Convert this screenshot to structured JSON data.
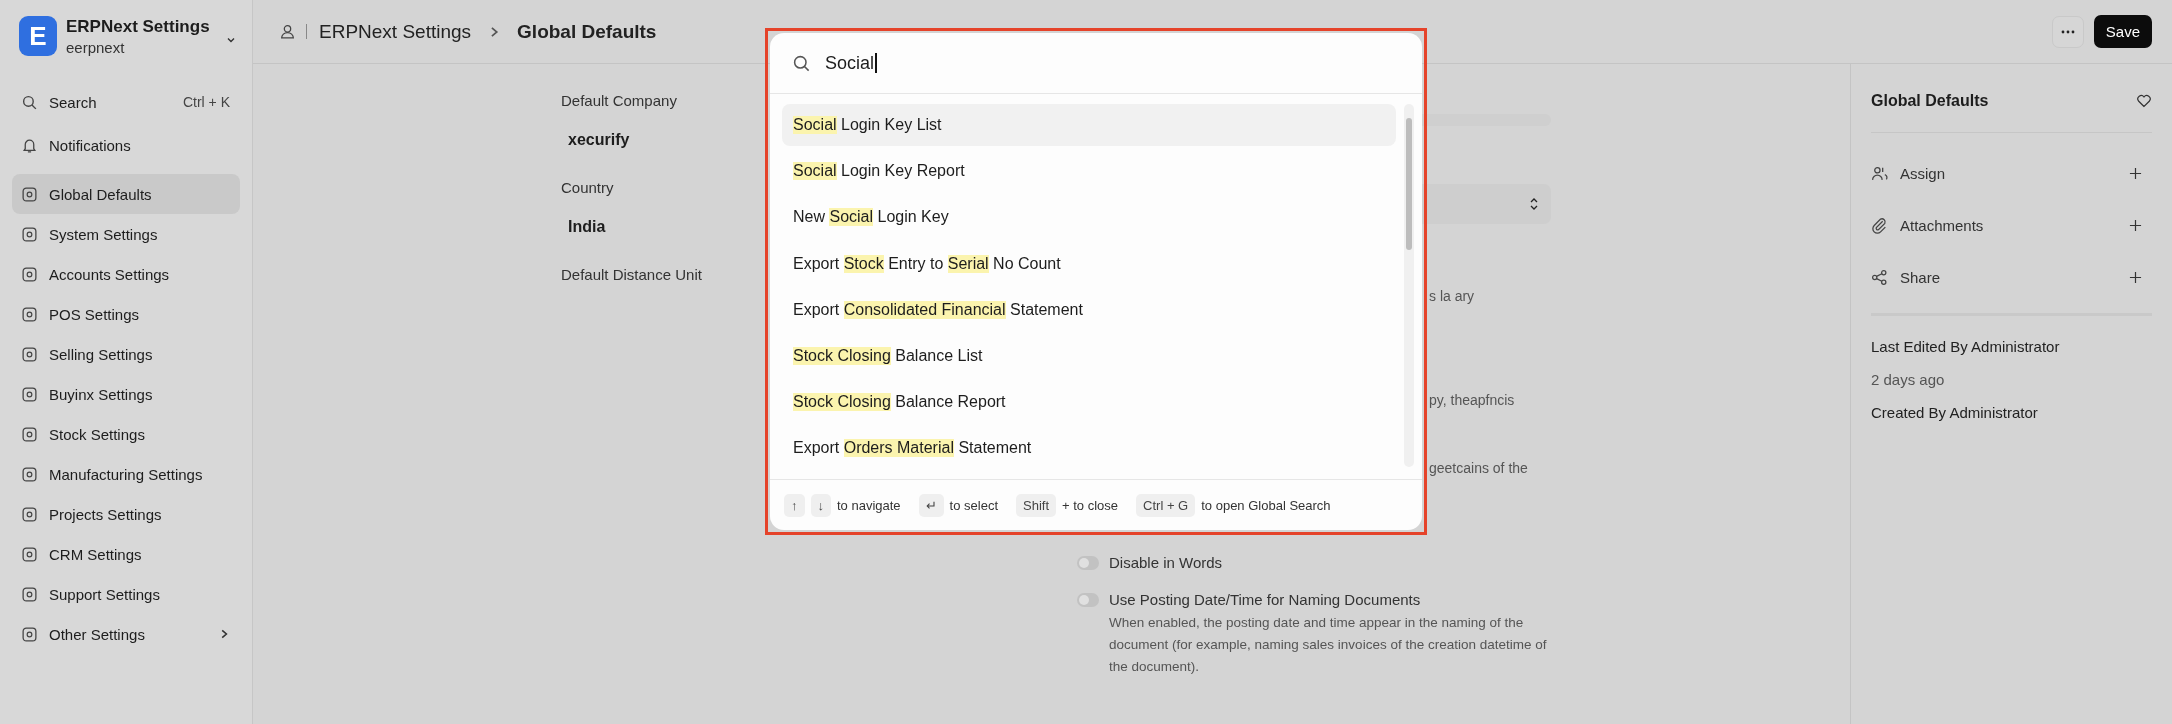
{
  "sidebar": {
    "app": {
      "logo": "E",
      "title": "ERPNext Settings",
      "subtitle": "eerpnext"
    },
    "search": {
      "label": "Search",
      "shortcut": "Ctrl + K"
    },
    "notifications": {
      "label": "Notifications"
    },
    "items": [
      {
        "label": "Global Defaults",
        "selected": true,
        "has_submenu": false
      },
      {
        "label": "System Settings",
        "selected": false,
        "has_submenu": false
      },
      {
        "label": "Accounts Settings",
        "selected": false,
        "has_submenu": false
      },
      {
        "label": "POS Settings",
        "selected": false,
        "has_submenu": false
      },
      {
        "label": "Selling Settings",
        "selected": false,
        "has_submenu": false
      },
      {
        "label": "Buyinx Settings",
        "selected": false,
        "has_submenu": false
      },
      {
        "label": "Stock Settings",
        "selected": false,
        "has_submenu": false
      },
      {
        "label": "Manufacturing Settings",
        "selected": false,
        "has_submenu": false
      },
      {
        "label": "Projects Settings",
        "selected": false,
        "has_submenu": false
      },
      {
        "label": "CRM Settings",
        "selected": false,
        "has_submenu": false
      },
      {
        "label": "Support Settings",
        "selected": false,
        "has_submenu": false
      },
      {
        "label": "Other Settings",
        "selected": false,
        "has_submenu": true
      }
    ]
  },
  "header": {
    "breadcrumbs": [
      "ERPNext Settings",
      "Global Defaults"
    ],
    "save_button": "Save"
  },
  "form": {
    "fields": [
      {
        "label": "Default Company",
        "value": "xecurify"
      },
      {
        "label": "Country",
        "value": "India"
      },
      {
        "label": "Default Distance Unit"
      }
    ],
    "fragments": [
      "s la ary",
      "py, theapfncis",
      "geetcains of the"
    ],
    "toggles": [
      {
        "label": "Disable in Words",
        "on": false
      },
      {
        "label": "Use Posting Date/Time for Naming Documents",
        "on": false,
        "description": "When enabled, the posting date and time appear in the naming of the document (for example, naming sales invoices of the creation datetime of the document)."
      }
    ]
  },
  "side_panel": {
    "title": "Global Defaults",
    "actions": [
      {
        "label": "Assign",
        "kind": "people"
      },
      {
        "label": "Attachments",
        "kind": "clip"
      },
      {
        "label": "Share",
        "kind": "share"
      }
    ],
    "last_edited": "Last Edited By Administrator",
    "last_edited_time": "2 days ago",
    "created": "Created By Administrator"
  },
  "search_dialog": {
    "query": "Social",
    "results": [
      {
        "selected": true,
        "parts": [
          {
            "text": "Social",
            "match": true
          },
          {
            "text": " Login Key List",
            "match": false
          }
        ]
      },
      {
        "selected": false,
        "parts": [
          {
            "text": "Social",
            "match": true
          },
          {
            "text": " Login Key Report",
            "match": false
          }
        ]
      },
      {
        "selected": false,
        "parts": [
          {
            "text": "New ",
            "match": false
          },
          {
            "text": "Social",
            "match": true
          },
          {
            "text": " Login Key",
            "match": false
          }
        ]
      },
      {
        "selected": false,
        "parts": [
          {
            "text": "Export ",
            "match": false
          },
          {
            "text": "Stock",
            "match": true
          },
          {
            "text": " Entry to ",
            "match": false
          },
          {
            "text": "Serial",
            "match": true
          },
          {
            "text": " No Count",
            "match": false
          }
        ]
      },
      {
        "selected": false,
        "parts": [
          {
            "text": "Export ",
            "match": false
          },
          {
            "text": "Consolidated Financial",
            "match": true
          },
          {
            "text": " Statement",
            "match": false
          }
        ]
      },
      {
        "selected": false,
        "parts": [
          {
            "text": "Stock Closing",
            "match": true
          },
          {
            "text": " Balance List",
            "match": false
          }
        ]
      },
      {
        "selected": false,
        "parts": [
          {
            "text": "Stock Closing",
            "match": true
          },
          {
            "text": " Balance Report",
            "match": false
          }
        ]
      },
      {
        "selected": false,
        "parts": [
          {
            "text": "Export ",
            "match": false
          },
          {
            "text": "Orders Material",
            "match": true
          },
          {
            "text": " Statement",
            "match": false
          }
        ]
      }
    ],
    "hints": [
      {
        "keys": [
          "↑",
          "↓"
        ],
        "label": "to navigate"
      },
      {
        "keys": [
          "↵"
        ],
        "label": "to select"
      },
      {
        "keys": [
          "Shift"
        ],
        "label": "+ to close"
      },
      {
        "keys": [
          "Ctrl + G"
        ],
        "label": "to open Global Search"
      }
    ]
  }
}
